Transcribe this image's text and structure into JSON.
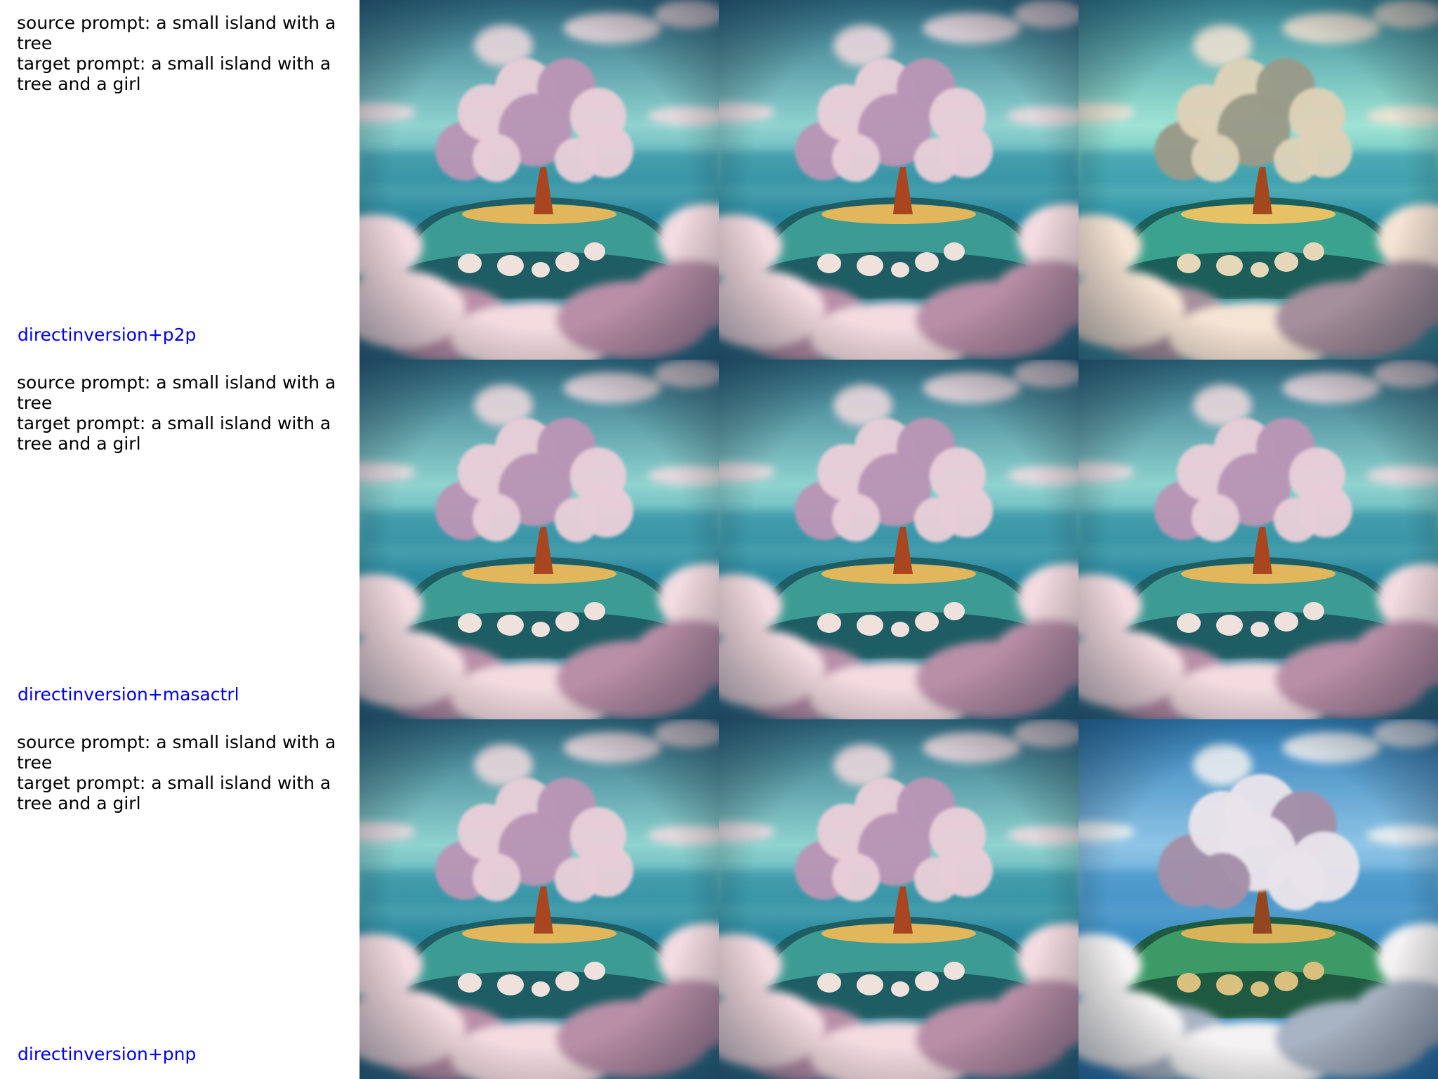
{
  "rows": [
    {
      "source_line": "source prompt: a small island with a\ntree",
      "target_line": "target prompt: a small island with a\ntree and a girl",
      "method": "directinversion+p2p",
      "images": [
        {
          "variant": "pink-puffball-tree-teal-sky"
        },
        {
          "variant": "pink-puffball-tree-teal-sky"
        },
        {
          "variant": "beige-fluffy-tree-mint-sky"
        }
      ]
    },
    {
      "source_line": "source prompt: a small island with a\ntree",
      "target_line": "target prompt: a small island with a\ntree and a girl",
      "method": "directinversion+masactrl",
      "images": [
        {
          "variant": "pink-puffball-tree-teal-sky"
        },
        {
          "variant": "pink-puffball-tree-teal-sky"
        },
        {
          "variant": "pink-puffball-tree-teal-sky"
        }
      ]
    },
    {
      "source_line": "source prompt: a small island with a\ntree",
      "target_line": "target prompt: a small island with a\ntree and a girl",
      "method": "directinversion+pnp",
      "images": [
        {
          "variant": "pink-puffball-tree-teal-sky"
        },
        {
          "variant": "pink-puffball-tree-teal-sky"
        },
        {
          "variant": "wispy-cloud-tree-blue-sky"
        }
      ]
    }
  ],
  "colors": {
    "caption_text": "#000000",
    "method_label": "#0000ee",
    "background": "#ffffff"
  }
}
